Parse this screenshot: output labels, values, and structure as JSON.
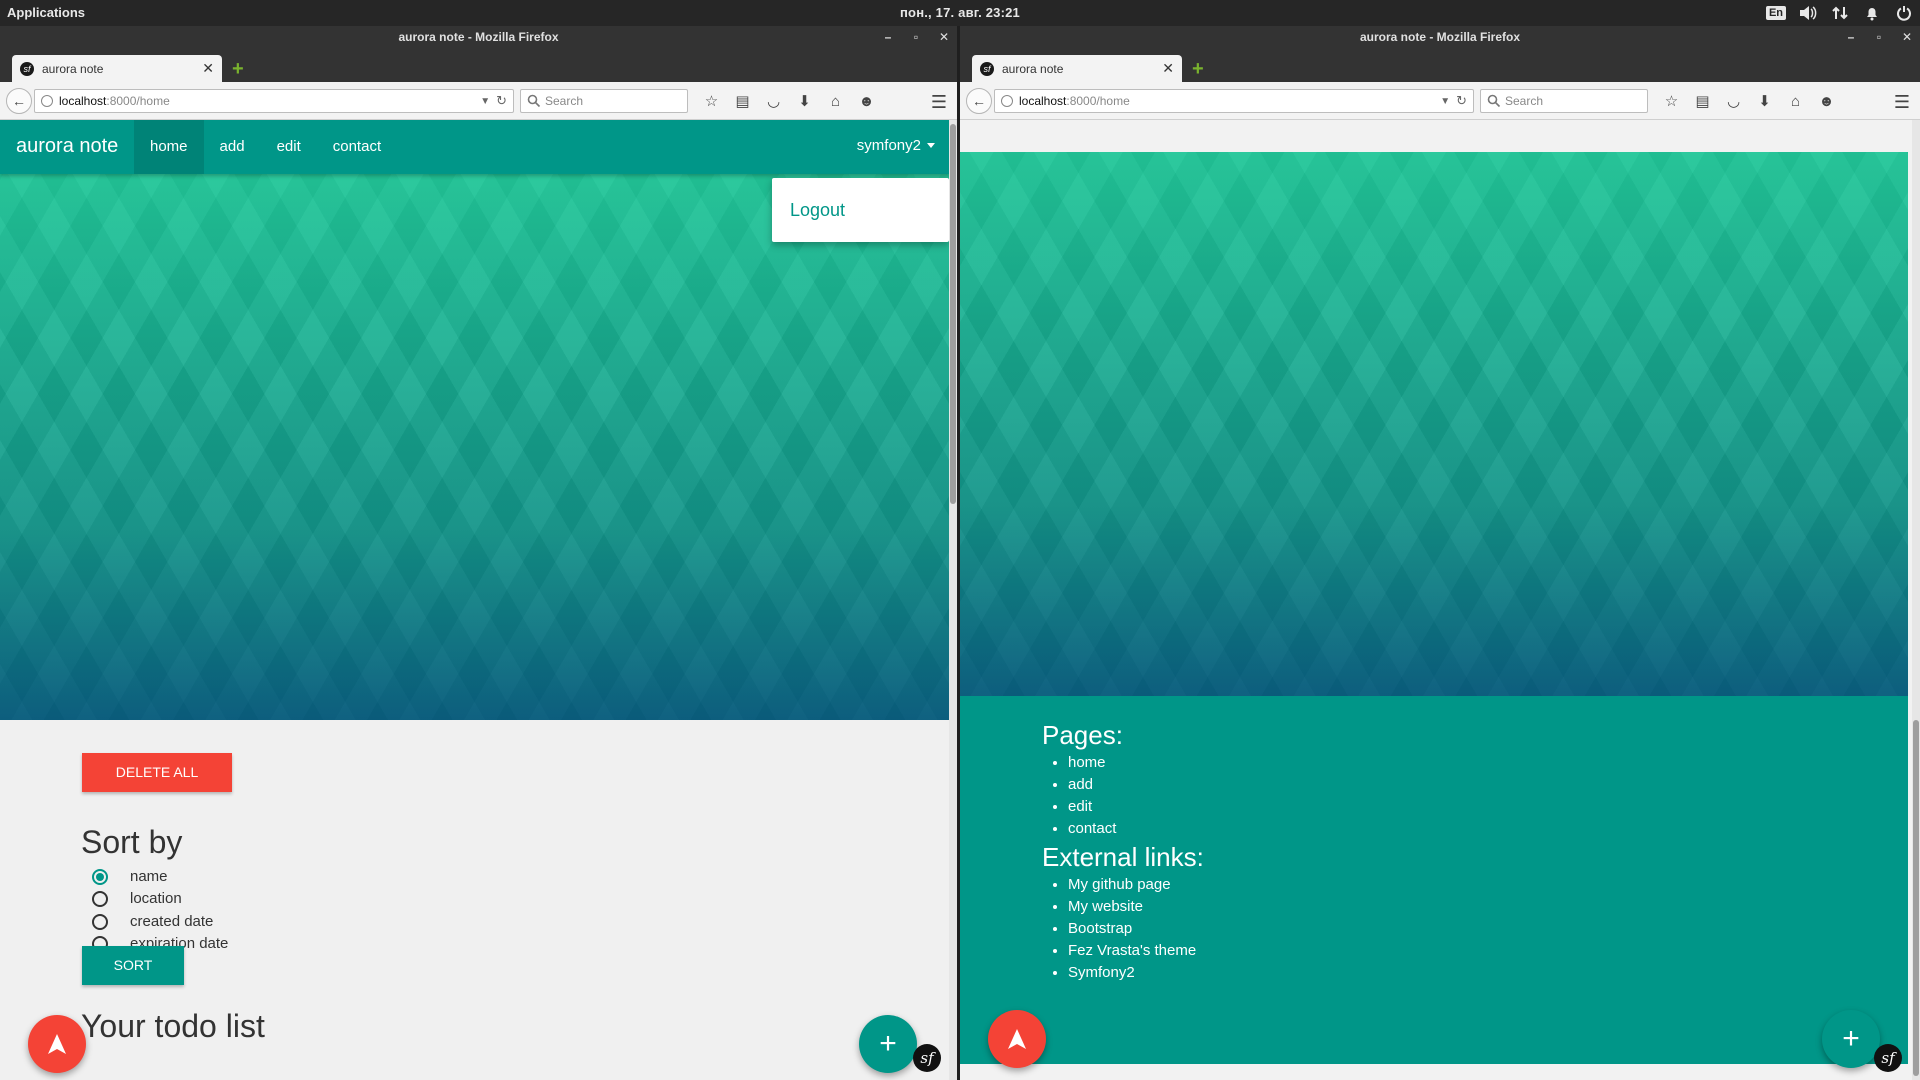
{
  "system": {
    "apps_label": "Applications",
    "clock": "пон., 17. авг.   23:21",
    "lang": "En"
  },
  "left_window": {
    "title": "aurora note - Mozilla Firefox",
    "tab_title": "aurora note",
    "url_host": "localhost",
    "url_path": ":8000/home",
    "search_placeholder": "Search"
  },
  "right_window": {
    "title": "aurora note - Mozilla Firefox",
    "tab_title": "aurora note",
    "url_host": "localhost",
    "url_path": ":8000/home",
    "search_placeholder": "Search"
  },
  "app": {
    "brand": "aurora note",
    "nav": [
      "home",
      "add",
      "edit",
      "contact"
    ],
    "user": "symfony2",
    "dropdown_logout": "Logout",
    "delete_all": "DELETE ALL",
    "sort_title": "Sort by",
    "sort_options": [
      "name",
      "location",
      "created date",
      "expiration date"
    ],
    "sort_selected": "name",
    "sort_button": "SORT",
    "todo_heading": "Your todo list",
    "fab_add": "+",
    "symfony_badge": "sf"
  },
  "footer": {
    "pages_heading": "Pages:",
    "pages": [
      "home",
      "add",
      "edit",
      "contact"
    ],
    "links_heading": "External links:",
    "links": [
      "My github page",
      "My website",
      "Bootstrap",
      "Fez Vrasta's theme",
      "Symfony2"
    ]
  },
  "colors": {
    "primary": "#009688",
    "accent": "#f44336",
    "panel": "#262626"
  }
}
